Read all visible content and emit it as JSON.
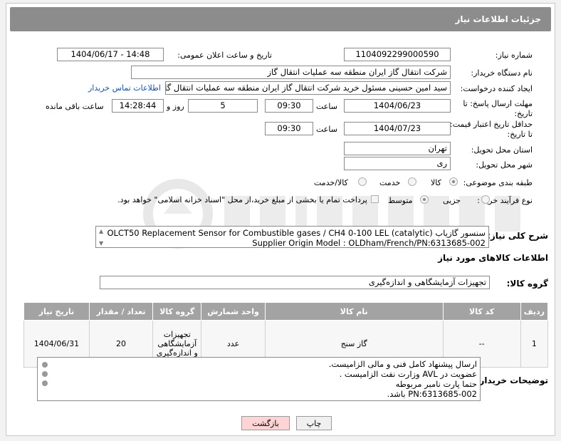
{
  "header": {
    "title": "جزئیات اطلاعات نیاز"
  },
  "fields": {
    "need_number_label": "شماره نیاز:",
    "need_number": "1104092299000590",
    "announce_label": "تاریخ و ساعت اعلان عمومی:",
    "announce_value": "1404/06/17 - 14:48",
    "buyer_org_label": "نام دستگاه خریدار:",
    "buyer_org": "شرکت انتقال گاز ایران منطقه سه عملیات انتقال گاز",
    "requester_label": "ایجاد کننده درخواست:",
    "requester": "سید امین حسینی مسئول خرید شرکت انتقال گاز ایران منطقه سه عملیات انتقال گاز",
    "contact_link": "اطلاعات تماس خریدار",
    "deadline_label_1": "مهلت ارسال پاسخ: تا",
    "deadline_label_2": "تاریخ:",
    "deadline_date": "1404/06/23",
    "time_label": "ساعت",
    "deadline_time": "09:30",
    "days_value": "5",
    "days_label": "روز و",
    "remaining_time": "14:28:44",
    "remaining_label": "ساعت باقی مانده",
    "validity_label_1": "حداقل تاریخ اعتبار قیمت:",
    "validity_label_2": "تا تاریخ:",
    "validity_date": "1404/07/23",
    "validity_time": "09:30",
    "province_label": "استان محل تحویل:",
    "province": "تهران",
    "city_label": "شهر محل تحویل:",
    "city": "ری",
    "category_label": "طبقه بندی موضوعی:",
    "category_options": [
      "کالا",
      "خدمت",
      "کالا/خدمت"
    ],
    "category_selected": "کالا",
    "process_label": "نوع فرآیند خرید :",
    "process_options": [
      "جزیی",
      "متوسط"
    ],
    "process_selected": "متوسط",
    "payment_note": "پرداخت تمام یا بخشی از مبلغ خرید،از محل \"اسناد خزانه اسلامی\" خواهد بود."
  },
  "need_description": {
    "label": "شرح کلی نیاز:",
    "line1": "OLCT50 Replacement Sensor for Combustible gases / CH4 0-100 LEL (catalytic) سنسور گازیاب",
    "line2": "Supplier Origin Model : OLDham/French/PN:6313685-002"
  },
  "goods_info": {
    "title": "اطلاعات کالاهای مورد نیاز",
    "group_label": "گروه کالا:",
    "group_value": "تجهیزات آزمایشگاهی و اندازه‌گیری"
  },
  "table": {
    "headers": [
      "ردیف",
      "کد کالا",
      "نام کالا",
      "واحد شمارش",
      "گروه کالا",
      "تعداد / مقدار",
      "تاریخ نیاز"
    ],
    "rows": [
      {
        "row": "1",
        "code": "--",
        "name": "گاز سنج",
        "unit": "عدد",
        "group": "تجهیزات آزمایشگاهی و اندازه‌گیری",
        "qty": "20",
        "date": "1404/06/31"
      }
    ]
  },
  "buyer_notes": {
    "label": "توضیحات خریدار:",
    "line1": "ارسال پیشنهاد کامل فنی و مالی الزامیست.",
    "line2": "عضویت در AVL وزارت نفت الزامیست .",
    "line3": "حتما پارت نامبر مربوطه",
    "line4": "PN:6313685-002 باشد."
  },
  "buttons": {
    "print": "چاپ",
    "back": "بازگشت"
  },
  "colors": {
    "header_bar": "#8c8c8c",
    "table_header": "#a3a3a3",
    "back_button": "#ffd4d4",
    "link": "#1a4fa0"
  }
}
